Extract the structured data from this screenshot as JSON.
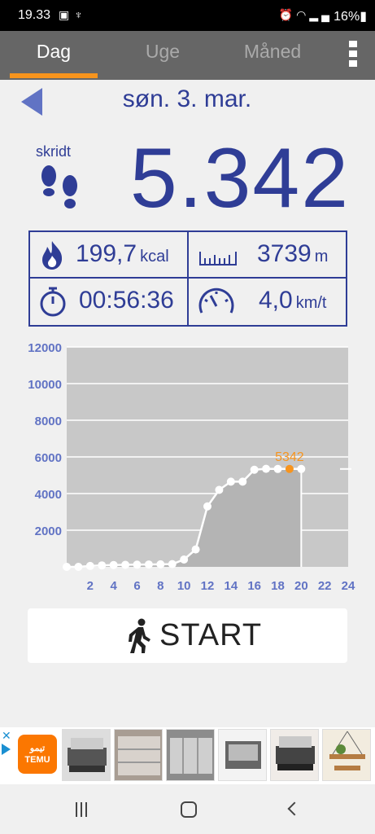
{
  "status_bar": {
    "time": "19.33",
    "battery": "16%",
    "icons": [
      "gallery-icon",
      "flashlight-icon",
      "alarm-icon",
      "wifi-icon",
      "signal-icon",
      "battery-icon"
    ]
  },
  "tabs": [
    {
      "label": "Dag",
      "active": true
    },
    {
      "label": "Uge",
      "active": false
    },
    {
      "label": "Måned",
      "active": false
    }
  ],
  "header": {
    "date": "søn. 3. mar."
  },
  "steps": {
    "label": "skridt",
    "value": "5.342"
  },
  "stats": {
    "calories": {
      "value": "199,7",
      "unit": "kcal",
      "icon": "flame-icon"
    },
    "distance": {
      "value": "3739",
      "unit": "m",
      "icon": "ruler-icon"
    },
    "duration": {
      "value": "00:56:36",
      "icon": "stopwatch-icon"
    },
    "speed": {
      "value": "4,0",
      "unit": "km/t",
      "icon": "speedometer-icon"
    }
  },
  "chart_data": {
    "type": "line",
    "x_ticks": [
      "2",
      "4",
      "6",
      "8",
      "10",
      "12",
      "14",
      "16",
      "18",
      "20",
      "22",
      "24"
    ],
    "y_ticks": [
      "2000",
      "4000",
      "6000",
      "8000",
      "10000",
      "12000"
    ],
    "ylim": [
      0,
      12000
    ],
    "xlim": [
      0,
      24
    ],
    "highlight_label": "5342",
    "highlight_index": 19,
    "current_hour": 20,
    "series": [
      {
        "x": [
          0,
          1,
          2,
          3,
          4,
          5,
          6,
          7,
          8,
          9,
          10,
          11,
          12,
          13,
          14,
          15,
          16,
          17,
          18,
          19,
          20
        ],
        "values": [
          0,
          0,
          50,
          80,
          100,
          110,
          120,
          130,
          140,
          150,
          400,
          950,
          3300,
          4200,
          4650,
          4650,
          5300,
          5350,
          5342,
          5342,
          5342
        ]
      }
    ],
    "colors": {
      "plot_bg": "#c8c8c8",
      "fill": "#b4b4b4",
      "line": "#ffffff",
      "tick": "#6173c4",
      "highlight": "#f7941d"
    }
  },
  "start_button": {
    "label": "START",
    "icon": "walking-person-icon"
  },
  "ad": {
    "brand_line1": "تيمو",
    "brand_line2": "TEMU"
  },
  "colors": {
    "primary": "#2f3d96",
    "accent": "#f7941d",
    "tab_bar": "#666666"
  }
}
